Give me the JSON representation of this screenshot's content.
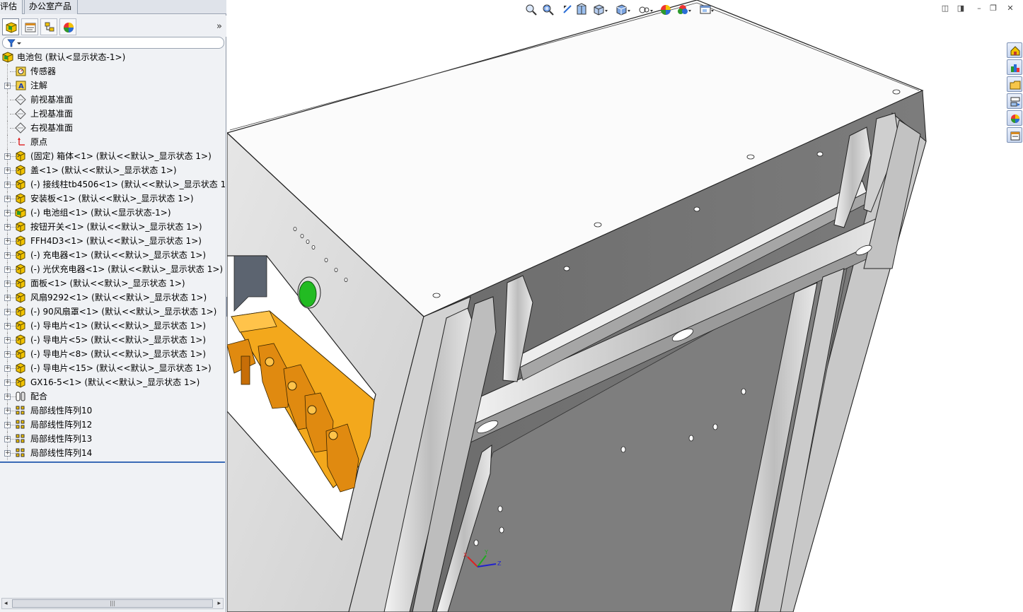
{
  "top_tabs": [
    "评估",
    "办公室产品"
  ],
  "feature_tree": {
    "root": "电池包  (默认<显示状态-1>)",
    "items": [
      {
        "label": "传感器",
        "icon": "sensor-icon",
        "expandable": false
      },
      {
        "label": "注解",
        "icon": "annotation-icon",
        "expandable": true
      },
      {
        "label": "前视基准面",
        "icon": "plane-icon",
        "expandable": false
      },
      {
        "label": "上视基准面",
        "icon": "plane-icon",
        "expandable": false
      },
      {
        "label": "右视基准面",
        "icon": "plane-icon",
        "expandable": false
      },
      {
        "label": "原点",
        "icon": "origin-icon",
        "expandable": false
      },
      {
        "label": "(固定) 箱体<1> (默认<<默认>_显示状态 1>)",
        "icon": "part-icon",
        "expandable": true
      },
      {
        "label": "盖<1> (默认<<默认>_显示状态 1>)",
        "icon": "part-icon",
        "expandable": true
      },
      {
        "label": "(-) 接线柱tb4506<1> (默认<<默认>_显示状态 1>",
        "icon": "part-icon",
        "expandable": true
      },
      {
        "label": "安装板<1> (默认<<默认>_显示状态 1>)",
        "icon": "part-icon",
        "expandable": true
      },
      {
        "label": "(-) 电池组<1> (默认<显示状态-1>)",
        "icon": "assembly-icon",
        "expandable": true
      },
      {
        "label": "按钮开关<1> (默认<<默认>_显示状态 1>)",
        "icon": "part-icon",
        "expandable": true
      },
      {
        "label": "FFH4D3<1> (默认<<默认>_显示状态 1>)",
        "icon": "part-icon",
        "expandable": true
      },
      {
        "label": "(-) 充电器<1> (默认<<默认>_显示状态 1>)",
        "icon": "part-icon",
        "expandable": true
      },
      {
        "label": "(-) 光伏充电器<1> (默认<<默认>_显示状态 1>)",
        "icon": "part-icon",
        "expandable": true
      },
      {
        "label": "面板<1> (默认<<默认>_显示状态 1>)",
        "icon": "part-icon",
        "expandable": true
      },
      {
        "label": "风扇9292<1> (默认<<默认>_显示状态 1>)",
        "icon": "part-icon",
        "expandable": true
      },
      {
        "label": "(-) 90风扇罩<1> (默认<<默认>_显示状态 1>)",
        "icon": "part-icon",
        "expandable": true
      },
      {
        "label": "(-) 导电片<1> (默认<<默认>_显示状态 1>)",
        "icon": "part-icon",
        "expandable": true
      },
      {
        "label": "(-) 导电片<5> (默认<<默认>_显示状态 1>)",
        "icon": "part-icon",
        "expandable": true
      },
      {
        "label": "(-) 导电片<8> (默认<<默认>_显示状态 1>)",
        "icon": "part-icon",
        "expandable": true
      },
      {
        "label": "(-) 导电片<15> (默认<<默认>_显示状态 1>)",
        "icon": "part-icon",
        "expandable": true
      },
      {
        "label": "GX16-5<1> (默认<<默认>_显示状态 1>)",
        "icon": "part-icon",
        "expandable": true
      },
      {
        "label": "配合",
        "icon": "mates-icon",
        "expandable": true
      },
      {
        "label": "局部线性阵列10",
        "icon": "pattern-icon",
        "expandable": true
      },
      {
        "label": "局部线性阵列12",
        "icon": "pattern-icon",
        "expandable": true
      },
      {
        "label": "局部线性阵列13",
        "icon": "pattern-icon",
        "expandable": true
      },
      {
        "label": "局部线性阵列14",
        "icon": "pattern-icon",
        "expandable": true
      }
    ]
  },
  "fm_tabs": [
    "featuremanager-tree-icon",
    "propertymanager-icon",
    "configurationmanager-icon",
    "displaymanager-icon"
  ],
  "view_toolbar": [
    "zoom-to-fit-icon",
    "zoom-to-area-icon",
    "previous-view-icon",
    "section-view-icon",
    "view-orientation-icon",
    "display-style-icon",
    "hide-show-items-icon",
    "edit-appearance-icon",
    "apply-scene-icon",
    "view-settings-icon"
  ],
  "task_pane": [
    "solidworks-resources-icon",
    "design-library-icon",
    "file-explorer-icon",
    "view-palette-icon",
    "appearances-icon",
    "custom-properties-icon"
  ],
  "triad_labels": {
    "x": "X",
    "y": "Y",
    "z": "Z"
  },
  "colors": {
    "panel_bg": "#f0f2f5",
    "terminal_orange": "#f5a623",
    "button_green": "#22bb22",
    "steel_dark": "#6f6f6f",
    "steel_light": "#d9d9d9"
  }
}
